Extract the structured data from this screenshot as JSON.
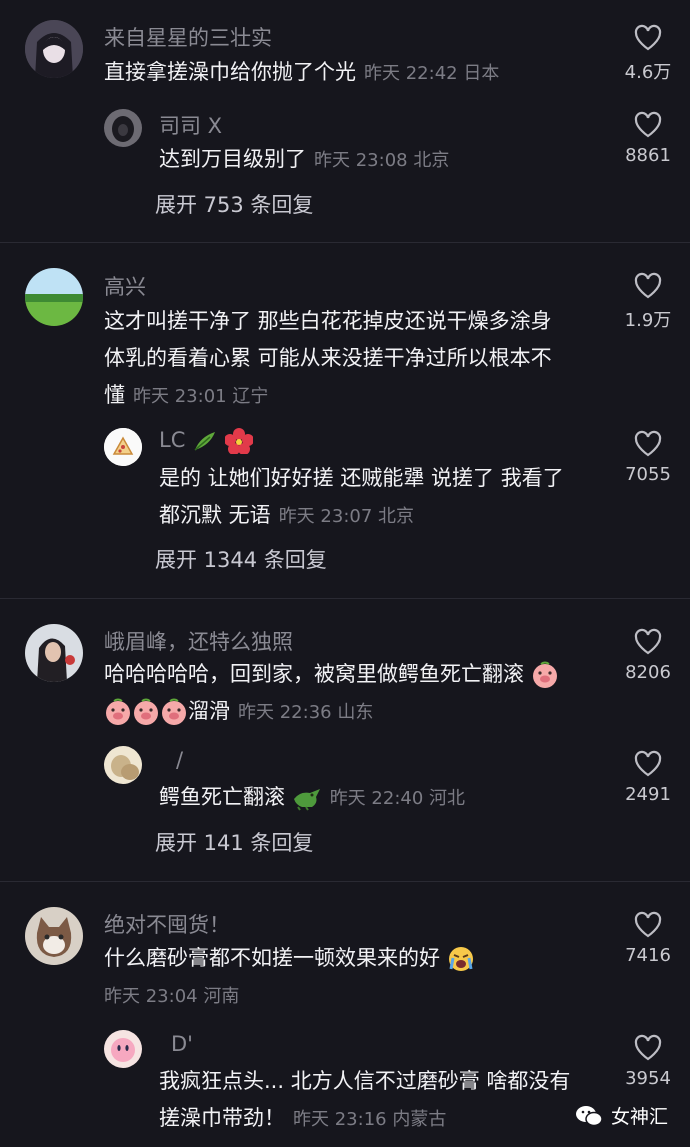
{
  "comments": [
    {
      "username": "来自星星的三壮实",
      "text": "直接拿搓澡巾给你抛了个光",
      "meta": "昨天 22:42 日本",
      "likes": "4.6万",
      "reply": {
        "username": "司司 X",
        "text": "达到万目级别了",
        "meta": "昨天 23:08 北京",
        "likes": "8861"
      },
      "expand": "展开 753 条回复"
    },
    {
      "username": "高兴",
      "text_lines": [
        "这才叫搓干净了  那些白花花掉皮还说干燥多涂身",
        "体乳的看着心累  可能从来没搓干净过所以根本不",
        "懂"
      ],
      "meta": "昨天 23:01 辽宁",
      "likes": "1.9万",
      "reply": {
        "username": "LC",
        "text_lines": [
          "是的 让她们好好搓 还贼能犟 说搓了 我看了",
          "都沉默 无语"
        ],
        "meta": "昨天 23:07 北京",
        "likes": "7055"
      },
      "expand": "展开 1344 条回复"
    },
    {
      "username": "峨眉峰，还特么独照",
      "text_lines": [
        "哈哈哈哈哈，回到家，被窝里做鳄鱼死亡翻滚",
        "溜滑"
      ],
      "meta": "昨天 22:36 山东",
      "likes": "8206",
      "reply": {
        "username": "/",
        "text": "鳄鱼死亡翻滚",
        "meta": "昨天 22:40 河北",
        "likes": "2491"
      },
      "expand": "展开 141 条回复"
    },
    {
      "username": "绝对不囤货！",
      "text": "什么磨砂膏都不如搓一顿效果来的好",
      "meta": "昨天 23:04 河南",
      "likes": "7416",
      "reply": {
        "username": "D'",
        "text_lines": [
          "我疯狂点头... 北方人信不过磨砂膏 啥都没有",
          "搓澡巾带劲！"
        ],
        "meta": "昨天 23:16 内蒙古",
        "likes": "3954"
      }
    }
  ],
  "watermark": "女神汇",
  "icons": {
    "like": "heart-outline-icon",
    "watermark": "wechat-icon"
  },
  "colors": {
    "background": "#16161d",
    "username": "#8a8a93",
    "text": "#f2f2f5",
    "meta": "#7c7c85"
  }
}
